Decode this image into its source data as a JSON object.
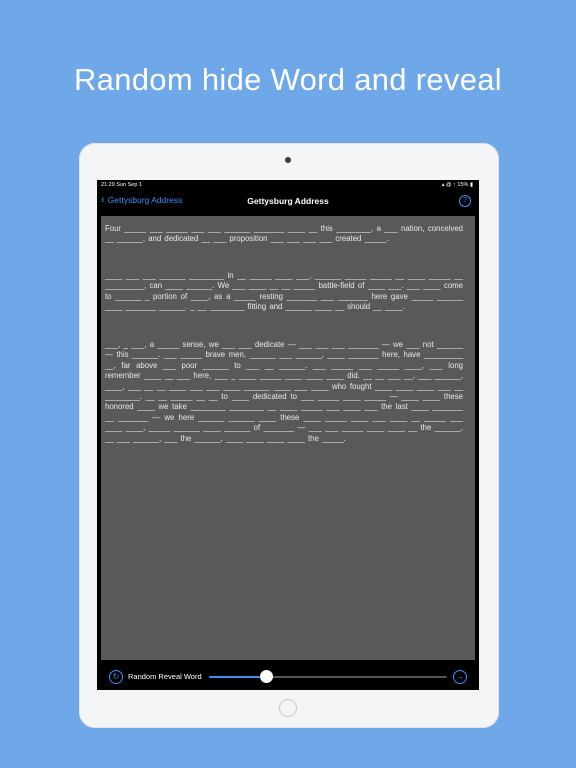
{
  "headline": "Random hide Word and reveal",
  "status": {
    "time_date": "21:29  Sun Sep 1",
    "indicators": "▴ @ ↑ 15% ▮"
  },
  "nav": {
    "back_label": "Gettysburg Address",
    "title": "Gettysburg Address",
    "help": "?"
  },
  "paragraphs": [
    "Four _____ ___ _____ ___ ___ ______ _______ ____ __ this ________, a ___ nation, conceived __ ______, and dedicated __ ___ proposition ___ ___ ___ ___ created _____.",
    "____ ___ ___ ______ ________ in __ _____ ____ ___, ______ _____ _____ __ ____ _____ __ _________, can ____ ______. We ___ ____ __ __ _____ battle-field of ____ ___. ___ ____ come to ______ _ portion of ____, as a _____ resting _______ ___ _______ here gave _____ ______ ____ _______ ______. _ __ ________ fitting and ______ ____ __ should __ ____.",
    "___, _ ___, a _____ sense, we ___ ___ dedicate — ___ ___ ___ _______ — we ___ not ______ — this ______. ___ _____ brave men, ______ ___ ______, ____ _______ here, have _________ __, far above ___ poor ______ to ___ __ ______. ___ _____ ___ _____ ____, ___ long remember ____ __ ___ here, ___ _ ____ _____ ____ ____ ____ did. __ __ ___ __, ___ ______, ____, ___ __ __ ____ ___ ___ ____ ______ ____ ___ ____ who fought ____ ____ ____ ___ __ ________. __ __ _____ __ __ to ____ dedicated to ___ _____ ____ _____ — ____ ____ these honored ____ we take ________ ________ __ ____ _____ ___ ____ ___ the last ____ _______ __ _______ — we here ______ ______ ____ these ____ _____ ____ ___ ____ __ _____ ___ ____ ____, _____ ______ ____ ______ of _______ — ___ ___ _____ ____ ____ __ the ______, __ ___ ______, ___ the ______, ____ ____ ____ ____ the _____."
  ],
  "toolbar": {
    "mode_label": "Random Reveal Word",
    "reset_icon": "↻",
    "next_icon": "→",
    "progress": 0.24
  }
}
